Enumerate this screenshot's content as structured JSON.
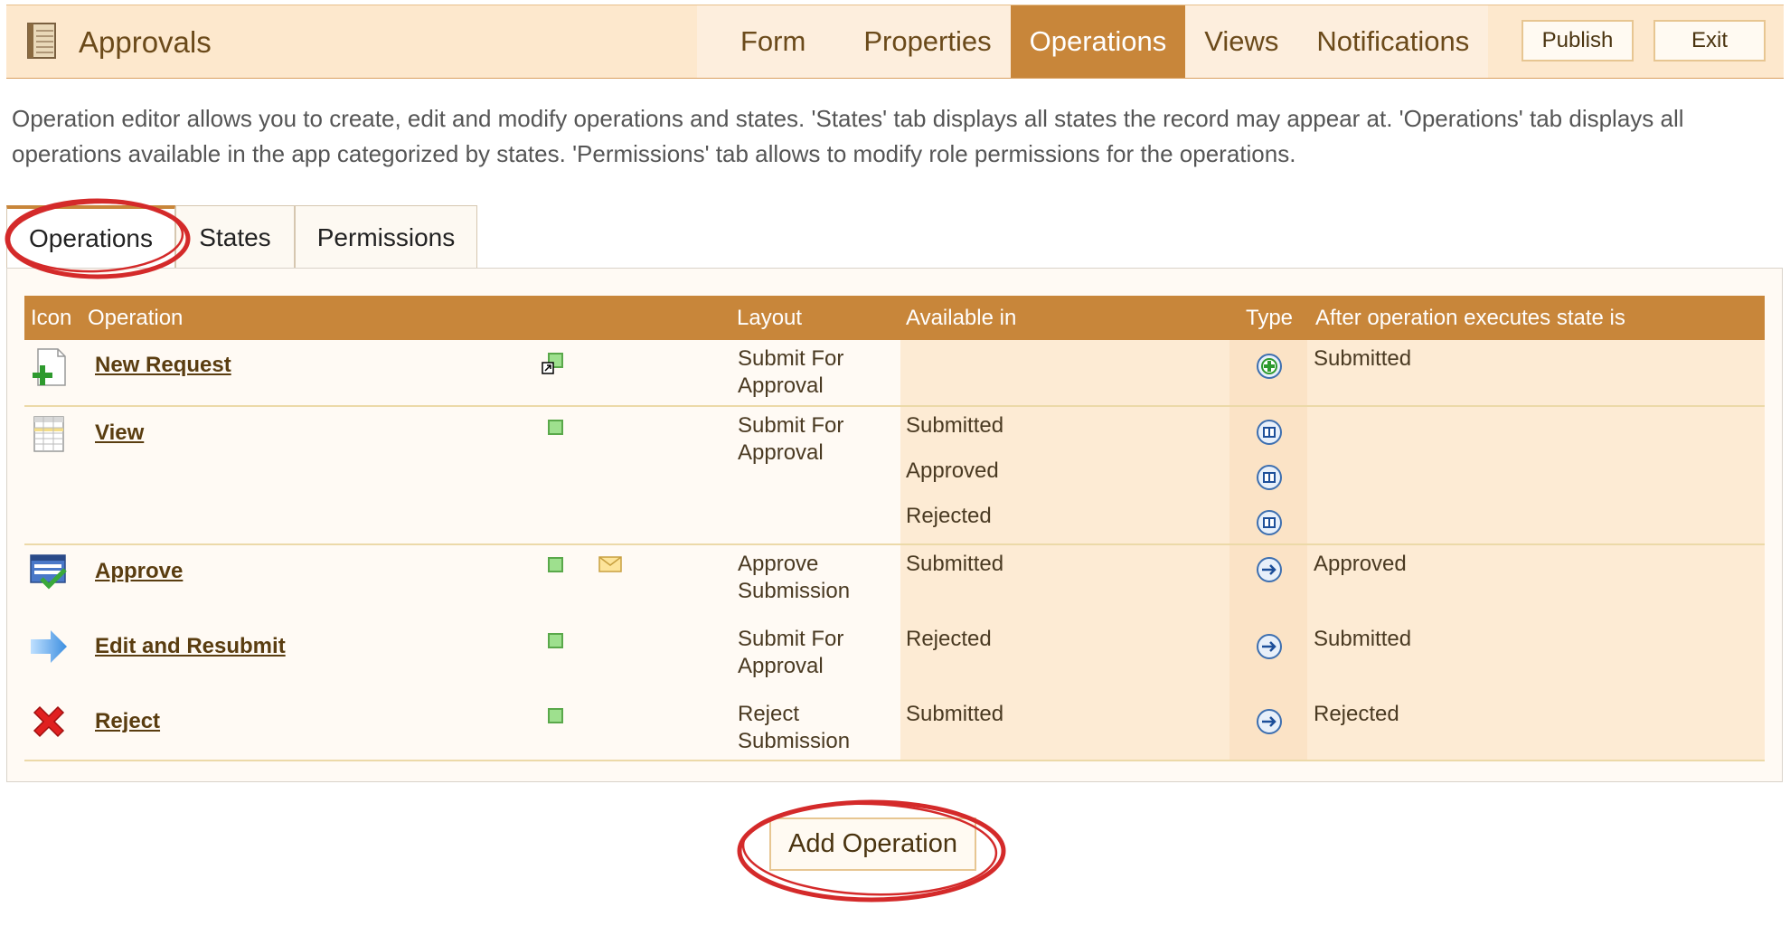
{
  "header": {
    "app_title": "Approvals",
    "nav_tabs": [
      {
        "label": "Form"
      },
      {
        "label": "Properties"
      },
      {
        "label": "Operations"
      },
      {
        "label": "Views"
      },
      {
        "label": "Notifications"
      }
    ],
    "active_tab": "Operations",
    "publish_label": "Publish",
    "exit_label": "Exit"
  },
  "description": "Operation editor allows you to create, edit and modify operations and states. 'States' tab displays all states the record may appear at. 'Operations' tab displays all operations available in the app categorized by states. 'Permissions' tab allows to modify role permissions for the operations.",
  "subtabs": [
    {
      "label": "Operations"
    },
    {
      "label": "States"
    },
    {
      "label": "Permissions"
    }
  ],
  "active_subtab": "Operations",
  "table": {
    "headers": {
      "icon": "Icon",
      "operation": "Operation",
      "layout": "Layout",
      "available_in": "Available in",
      "type": "Type",
      "after": "After operation executes state is"
    },
    "rows": [
      {
        "icon": "new-document-plus-icon",
        "operation": "New Request",
        "layout_line1": "Submit For",
        "layout_line2": "Approval",
        "available_in": [
          ""
        ],
        "type_icons": [
          "add-circle-icon"
        ],
        "after": "Submitted"
      },
      {
        "icon": "grid-sheet-icon",
        "operation": "View",
        "layout_line1": "Submit For",
        "layout_line2": "Approval",
        "available_in": [
          "Submitted",
          "Approved",
          "Rejected"
        ],
        "type_icons": [
          "view-circle-icon",
          "view-circle-icon",
          "view-circle-icon"
        ],
        "after": ""
      },
      {
        "icon": "approve-form-check-icon",
        "operation": "Approve",
        "layout_line1": "Approve",
        "layout_line2": "Submission",
        "available_in": [
          "Submitted"
        ],
        "type_icons": [
          "transition-arrow-circle-icon"
        ],
        "after": "Approved"
      },
      {
        "icon": "blue-arrow-right-icon",
        "operation": "Edit and Resubmit",
        "layout_line1": "Submit For",
        "layout_line2": "Approval",
        "available_in": [
          "Rejected"
        ],
        "type_icons": [
          "transition-arrow-circle-icon"
        ],
        "after": "Submitted"
      },
      {
        "icon": "red-x-icon",
        "operation": "Reject",
        "layout_line1": "Reject",
        "layout_line2": "Submission",
        "available_in": [
          "Submitted"
        ],
        "type_icons": [
          "transition-arrow-circle-icon"
        ],
        "after": "Rejected"
      }
    ]
  },
  "add_operation_label": "Add Operation",
  "colors": {
    "accent": "#c8863a",
    "header_bg": "#fde8cd",
    "annotation": "#d42a2a"
  }
}
